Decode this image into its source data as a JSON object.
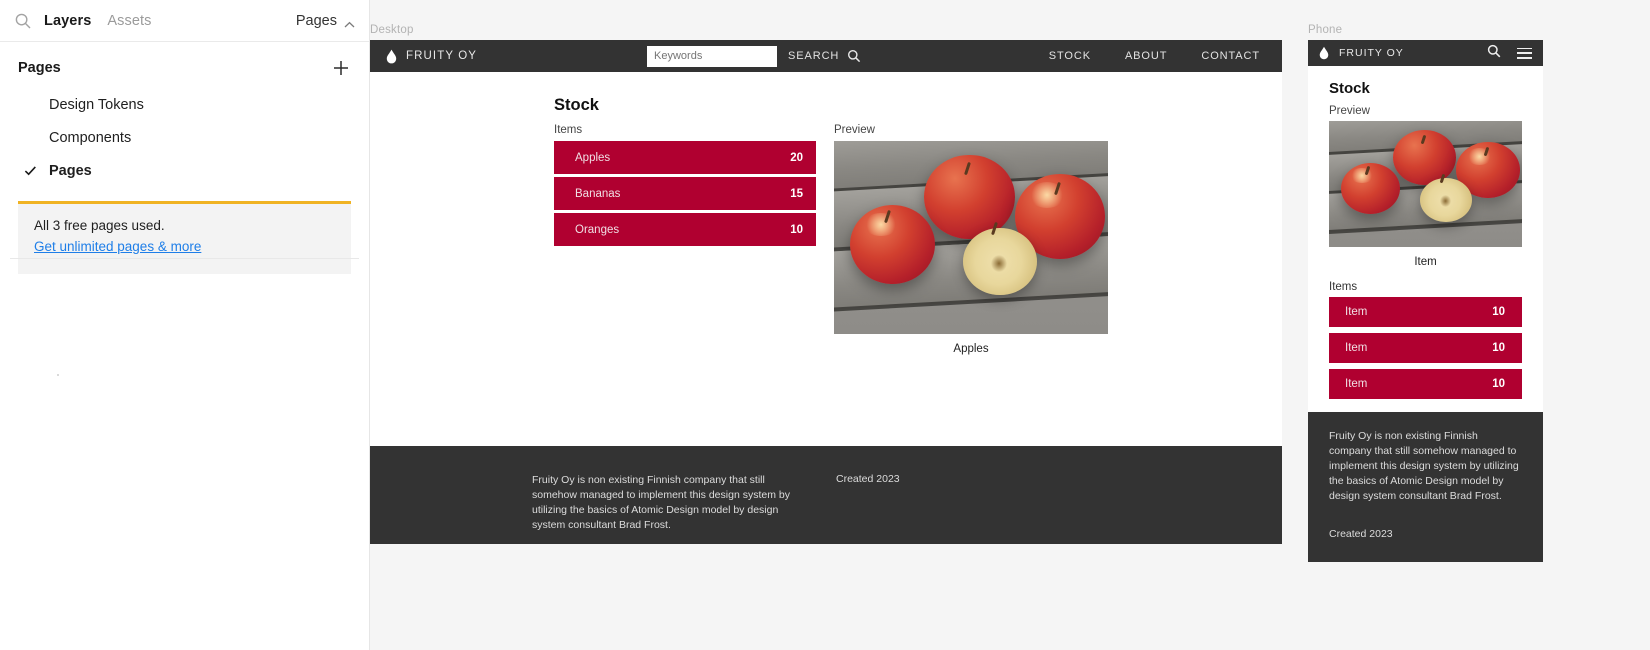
{
  "editor": {
    "tabs": [
      {
        "label": "Layers",
        "active": true
      },
      {
        "label": "Assets",
        "active": false
      }
    ],
    "search_icon": "search-icon",
    "page_selector": {
      "label": "Pages",
      "icon": "chevron-up-icon"
    },
    "pages_section": {
      "title": "Pages",
      "add_icon": "plus-icon",
      "items": [
        {
          "label": "Design Tokens",
          "selected": false
        },
        {
          "label": "Components",
          "selected": false
        },
        {
          "label": "Pages",
          "selected": true,
          "check_icon": "check-icon"
        }
      ]
    },
    "notice": {
      "message": "All 3 free pages used.",
      "link": "Get unlimited pages & more",
      "accent_color": "#f0b323",
      "link_color": "#1e7ee8",
      "background": "#f3f3f3"
    }
  },
  "canvas": {
    "background": "#f5f5f5",
    "frames": [
      {
        "name": "Desktop"
      },
      {
        "name": "Phone"
      }
    ]
  },
  "desktop": {
    "frame_label": "Desktop",
    "header": {
      "logo_icon": "water-drop-icon",
      "brand": "FRUITY  OY",
      "search_input_value": "",
      "search_placeholder": "Keywords",
      "search_label": "SEARCH",
      "search_icon": "magnifier-icon",
      "nav": [
        "STOCK",
        "ABOUT",
        "CONTACT"
      ],
      "background": "#333333"
    },
    "page_title": "Stock",
    "items_label": "Items",
    "items": [
      {
        "name": "Apples",
        "qty": "20"
      },
      {
        "name": "Bananas",
        "qty": "15"
      },
      {
        "name": "Oranges",
        "qty": "10"
      }
    ],
    "preview": {
      "label": "Preview",
      "image_alt": "three red apples and one halved apple on weathered grey wooden planks",
      "caption": "Apples"
    },
    "footer": {
      "text": "Fruity Oy is non existing Finnish company that still somehow managed to implement this design system by utilizing the basics of Atomic Design model by design system consultant Brad Frost.",
      "created": "Created 2023",
      "background": "#333333"
    }
  },
  "phone": {
    "frame_label": "Phone",
    "header": {
      "logo_icon": "water-drop-icon",
      "brand": "FRUITY  OY",
      "search_icon": "magnifier-icon",
      "menu_icon": "hamburger-menu-icon",
      "background": "#333333"
    },
    "page_title": "Stock",
    "preview": {
      "label": "Preview",
      "image_alt": "three red apples and one halved apple on weathered grey wooden planks",
      "caption": "Item"
    },
    "items_label": "Items",
    "items": [
      {
        "name": "Item",
        "qty": "10"
      },
      {
        "name": "Item",
        "qty": "10"
      },
      {
        "name": "Item",
        "qty": "10"
      }
    ],
    "footer": {
      "text": "Fruity Oy is non existing Finnish company that still somehow managed to implement this design system by utilizing the basics of Atomic Design model by design system consultant Brad Frost.",
      "created": "Created 2023",
      "background": "#333333"
    }
  },
  "theme": {
    "item_row_color": "#B00030",
    "dark": "#333333",
    "text_light": "#dcdcdc"
  }
}
